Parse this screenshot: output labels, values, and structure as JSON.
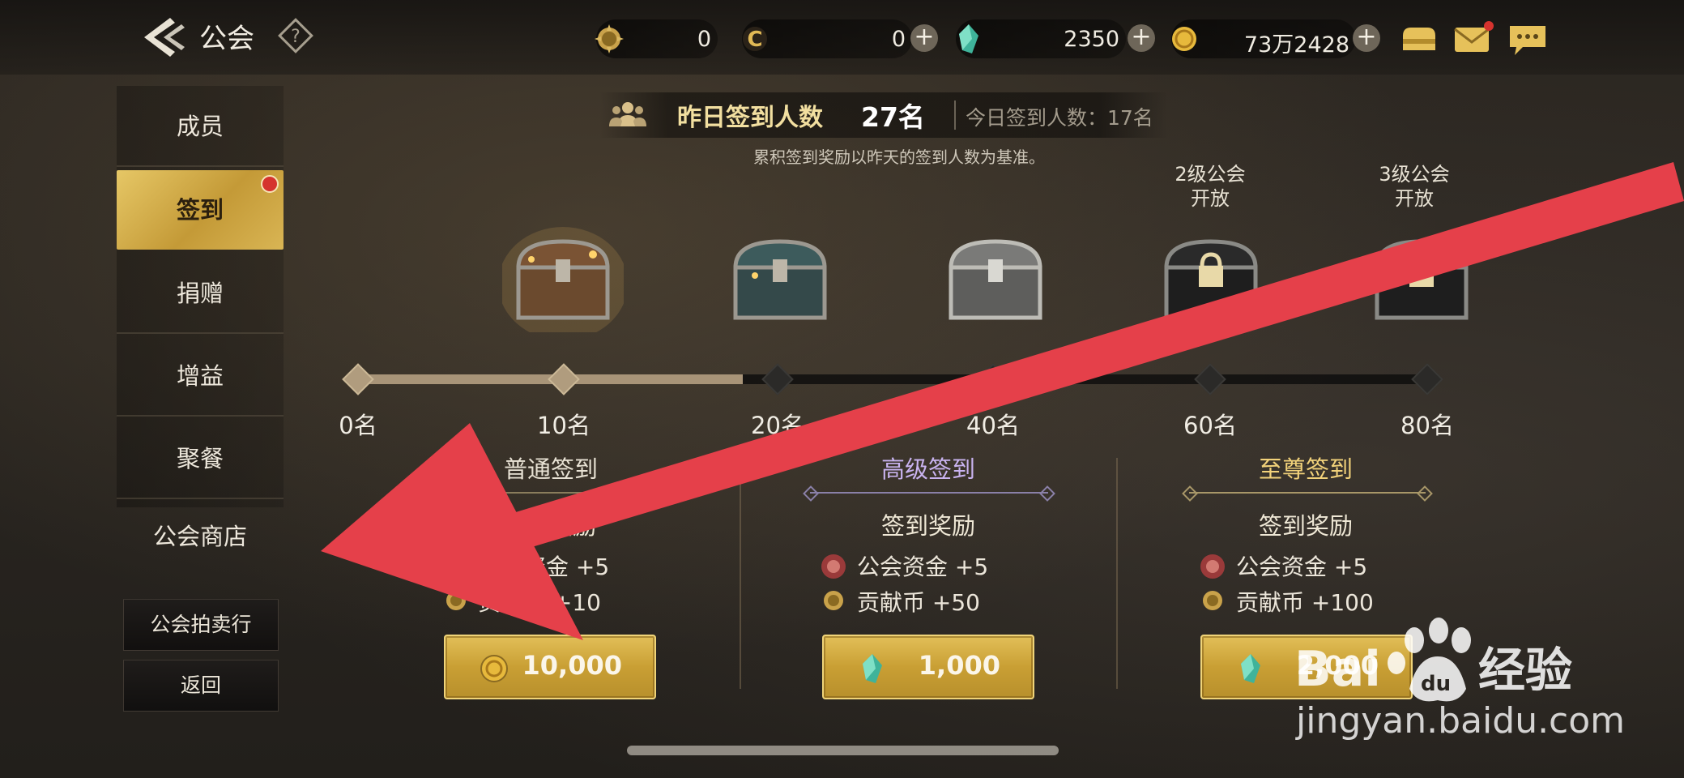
{
  "header": {
    "title": "公会",
    "currencies": [
      {
        "icon": "contribution-coin-icon",
        "value": "0"
      },
      {
        "icon": "guild-currency-icon",
        "value": "0"
      },
      {
        "icon": "crystal-icon",
        "value": "2350"
      },
      {
        "icon": "gold-coin-icon",
        "value": "73万2428"
      }
    ],
    "plus": "+",
    "right_icons": [
      "wallet-icon",
      "mail-icon",
      "chat-icon"
    ]
  },
  "sidebar": {
    "items": [
      {
        "label": "成员"
      },
      {
        "label": "签到"
      },
      {
        "label": "捐赠"
      },
      {
        "label": "增益"
      },
      {
        "label": "聚餐"
      },
      {
        "label": "公会商店"
      }
    ],
    "auction_label": "公会拍卖行",
    "back_label": "返回"
  },
  "signin": {
    "yesterday_label": "昨日签到人数",
    "yesterday_count": "27名",
    "today_label": "今日签到人数：17名",
    "note": "累积签到奖励以昨天的签到人数为基准。",
    "chest_locks": [
      "2级公会\n开放",
      "3级公会\n开放"
    ],
    "milestones": [
      "0名",
      "10名",
      "20名",
      "40名",
      "60名",
      "80名"
    ],
    "progress": 0.36
  },
  "cards": [
    {
      "title": "普通签到",
      "reward_head": "签到奖励",
      "rewards": [
        "公会资金 +5",
        "贡献币 +10"
      ],
      "price": "10,000",
      "price_icon": "gold-coin-icon",
      "title_color": "#e8e2d4"
    },
    {
      "title": "高级签到",
      "reward_head": "签到奖励",
      "rewards": [
        "公会资金 +5",
        "贡献币 +50"
      ],
      "price": "1,000",
      "price_icon": "crystal-icon",
      "title_color": "#c9b3f0"
    },
    {
      "title": "至尊签到",
      "reward_head": "签到奖励",
      "rewards": [
        "公会资金 +5",
        "贡献币 +100"
      ],
      "price": "2,000",
      "price_icon": "crystal-icon",
      "title_color": "#f2d27a"
    }
  ],
  "colors": {
    "accent_gold": "#d4af46",
    "annotation_red": "#e5404a"
  },
  "watermark": {
    "brand": "Bai",
    "suffix": "经验",
    "url": "jingyan.baidu.com"
  }
}
